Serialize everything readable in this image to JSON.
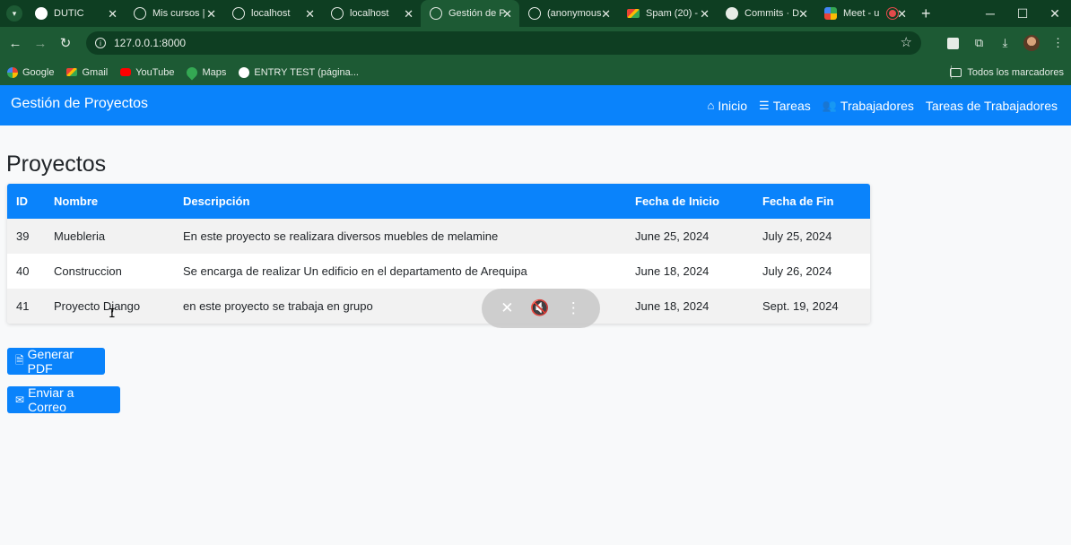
{
  "browser": {
    "tabs": [
      {
        "label": "DUTIC",
        "icon": "dutic",
        "active": false
      },
      {
        "label": "Mis cursos |",
        "icon": "globe",
        "active": false
      },
      {
        "label": "localhost",
        "icon": "globe",
        "active": false
      },
      {
        "label": "localhost",
        "icon": "globe",
        "active": false
      },
      {
        "label": "Gestión de P",
        "icon": "globe",
        "active": true
      },
      {
        "label": "(anonymous",
        "icon": "globe",
        "active": false
      },
      {
        "label": "Spam (20) -",
        "icon": "gmail",
        "active": false
      },
      {
        "label": "Commits · D",
        "icon": "github",
        "active": false
      },
      {
        "label": "Meet - u",
        "icon": "meet",
        "active": false
      }
    ],
    "url": "127.0.0.1:8000",
    "bookmarks": [
      {
        "label": "Google",
        "icon": "google"
      },
      {
        "label": "Gmail",
        "icon": "gmail"
      },
      {
        "label": "YouTube",
        "icon": "yt"
      },
      {
        "label": "Maps",
        "icon": "maps"
      },
      {
        "label": "ENTRY TEST (página...",
        "icon": "entry"
      }
    ],
    "all_bookmarks": "Todos los marcadores"
  },
  "navbar": {
    "brand": "Gestión de Proyectos",
    "links": [
      {
        "label": "Inicio",
        "icon": "home-icon"
      },
      {
        "label": "Tareas",
        "icon": "tasks-icon"
      },
      {
        "label": "Trabajadores",
        "icon": "users-icon"
      },
      {
        "label": "Tareas de Trabajadores",
        "icon": ""
      }
    ]
  },
  "main": {
    "title": "Proyectos",
    "table": {
      "headers": [
        "ID",
        "Nombre",
        "Descripción",
        "Fecha de Inicio",
        "Fecha de Fin"
      ],
      "rows": [
        [
          "39",
          "Muebleria",
          "En este proyecto se realizara diversos muebles de melamine",
          "June 25, 2024",
          "July 25, 2024"
        ],
        [
          "40",
          "Construccion",
          "Se encarga de realizar Un edificio en el departamento de Arequipa",
          "June 18, 2024",
          "July 26, 2024"
        ],
        [
          "41",
          "Proyecto Django",
          "en este proyecto se trabaja en grupo",
          "June 18, 2024",
          "Sept. 19, 2024"
        ]
      ]
    },
    "buttons": {
      "pdf": "Generar PDF",
      "mail": "Enviar a Correo"
    }
  },
  "colors": {
    "primary": "#0a83fb",
    "chrome_dark": "#0e3e22",
    "chrome": "#1d5a34"
  }
}
